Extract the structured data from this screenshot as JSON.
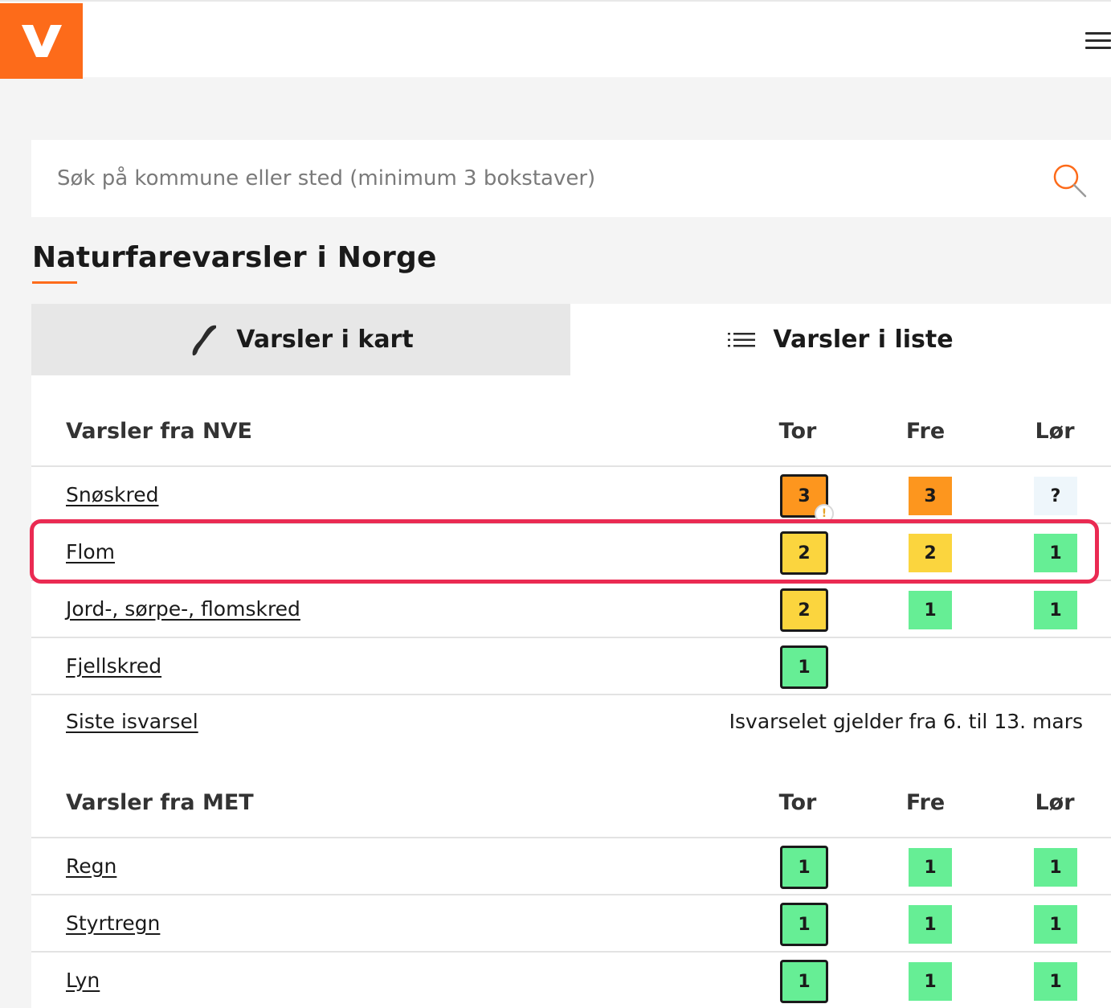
{
  "header": {
    "logo_letter": "V",
    "brand_color": "#fd6b1a",
    "menu_icon": "hamburger-menu-icon"
  },
  "search": {
    "placeholder": "Søk på kommune eller sted (minimum 3 bokstaver)",
    "value": "",
    "icon": "search-icon"
  },
  "page": {
    "title": "Naturfarevarsler i Norge"
  },
  "tabs": [
    {
      "label": "Varsler i kart",
      "icon": "norway-map-icon",
      "active": true
    },
    {
      "label": "Varsler i liste",
      "icon": "list-icon",
      "active": false
    }
  ],
  "level_colors": {
    "1": "#66ee95",
    "2": "#fbd53e",
    "3": "#fd961e",
    "?": "#eef6fb"
  },
  "nve": {
    "title": "Varsler fra NVE",
    "days": [
      "Tor",
      "Fre",
      "Lør"
    ],
    "rows": [
      {
        "label": "Snøskred",
        "levels": [
          "3",
          "3",
          "?"
        ],
        "today_warning": true
      },
      {
        "label": "Flom",
        "levels": [
          "2",
          "2",
          "1"
        ],
        "highlighted": true
      },
      {
        "label": "Jord-, sørpe-, flomskred",
        "levels": [
          "2",
          "1",
          "1"
        ]
      },
      {
        "label": "Fjellskred",
        "levels": [
          "1"
        ]
      }
    ],
    "ice": {
      "label": "Siste isvarsel",
      "text": "Isvarselet gjelder fra 6. til 13. mars"
    }
  },
  "met": {
    "title": "Varsler fra MET",
    "days": [
      "Tor",
      "Fre",
      "Lør"
    ],
    "rows": [
      {
        "label": "Regn",
        "levels": [
          "1",
          "1",
          "1"
        ]
      },
      {
        "label": "Styrtregn",
        "levels": [
          "1",
          "1",
          "1"
        ]
      },
      {
        "label": "Lyn",
        "levels": [
          "1",
          "1",
          "1"
        ]
      }
    ]
  },
  "warning_badge": "!",
  "highlight_color": "#ea2a52"
}
